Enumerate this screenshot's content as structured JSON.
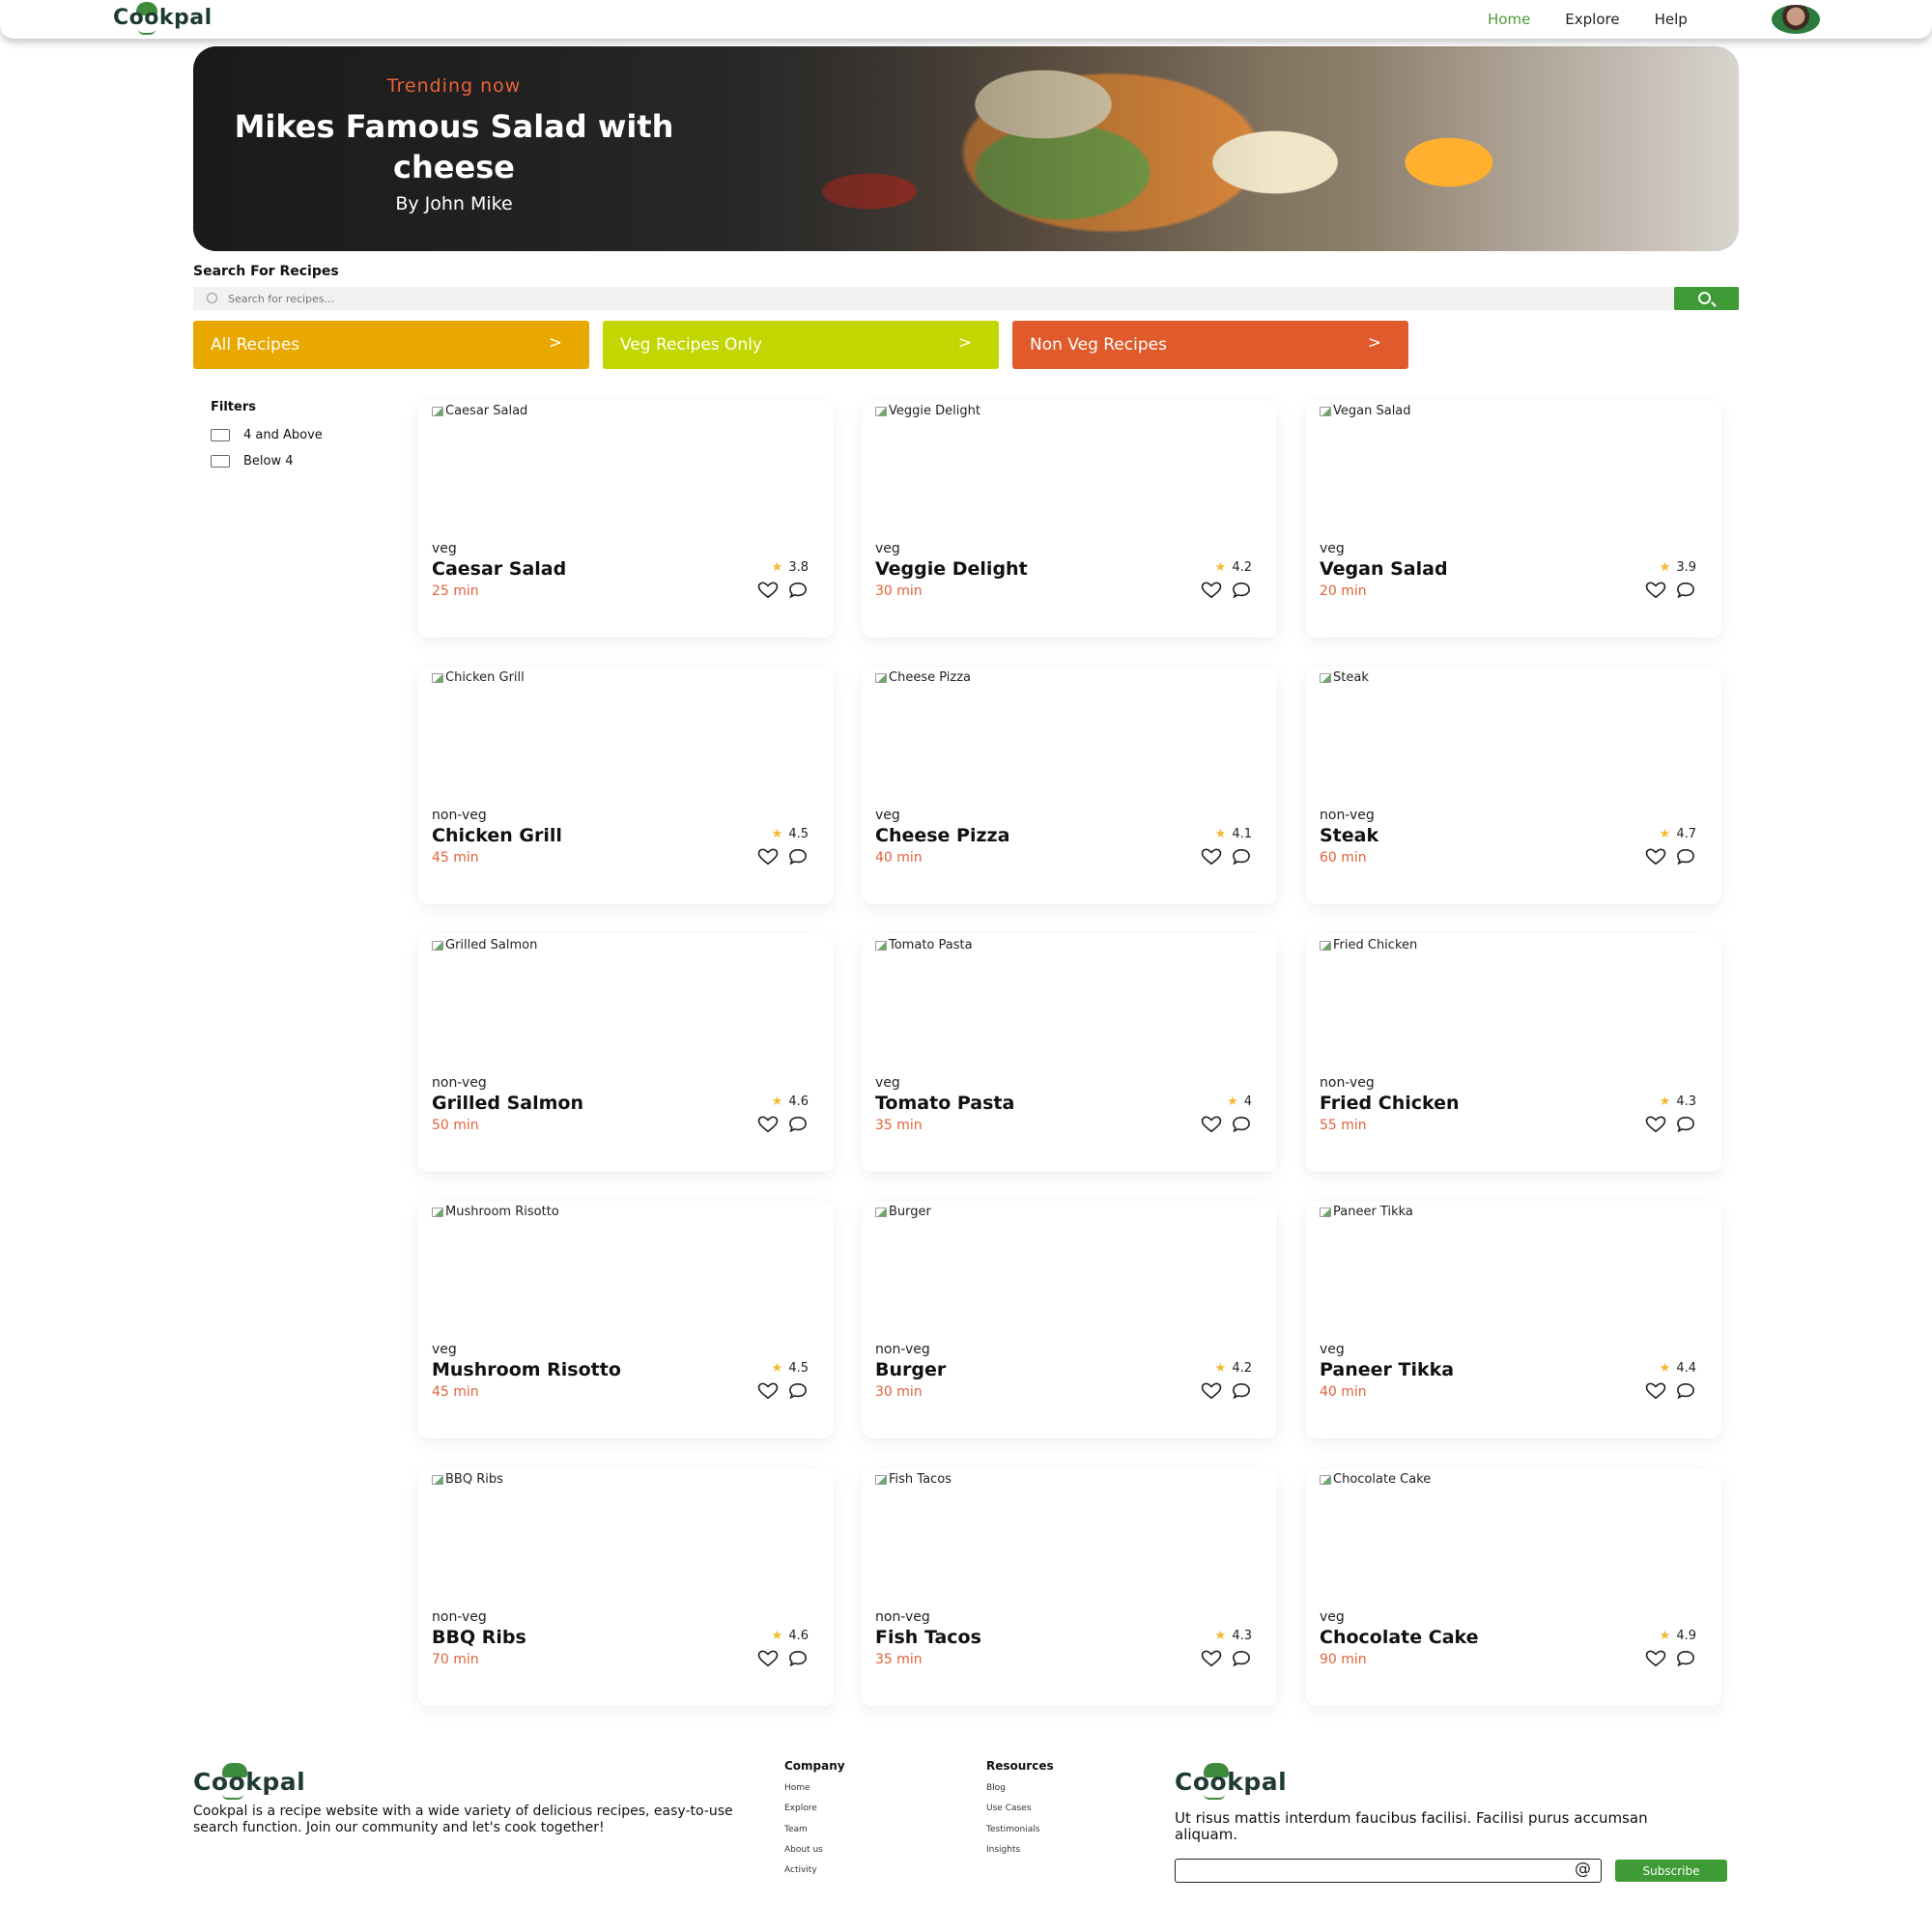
{
  "header": {
    "logo": "Cookpal",
    "nav": [
      {
        "label": "Home",
        "active": true
      },
      {
        "label": "Explore",
        "active": false
      },
      {
        "label": "Help",
        "active": false
      }
    ]
  },
  "hero": {
    "kicker": "Trending now",
    "title": "Mikes Famous Salad with cheese",
    "author": "By John Mike"
  },
  "search": {
    "label": "Search For Recipes",
    "placeholder": "Search for recipes..."
  },
  "categories": [
    {
      "label": "All Recipes",
      "chevron": ">",
      "color": "#e9a800"
    },
    {
      "label": "Veg Recipes Only",
      "chevron": ">",
      "color": "#c3d600"
    },
    {
      "label": "Non Veg Recipes",
      "chevron": ">",
      "color": "#e05a2b"
    }
  ],
  "filters": {
    "title": "Filters",
    "options": [
      "4 and Above",
      "Below 4"
    ]
  },
  "recipes": [
    {
      "name": "Caesar Salad",
      "type": "veg",
      "time": "25 min",
      "rating": "3.8"
    },
    {
      "name": "Veggie Delight",
      "type": "veg",
      "time": "30 min",
      "rating": "4.2"
    },
    {
      "name": "Vegan Salad",
      "type": "veg",
      "time": "20 min",
      "rating": "3.9"
    },
    {
      "name": "Chicken Grill",
      "type": "non-veg",
      "time": "45 min",
      "rating": "4.5"
    },
    {
      "name": "Cheese Pizza",
      "type": "veg",
      "time": "40 min",
      "rating": "4.1"
    },
    {
      "name": "Steak",
      "type": "non-veg",
      "time": "60 min",
      "rating": "4.7"
    },
    {
      "name": "Grilled Salmon",
      "type": "non-veg",
      "time": "50 min",
      "rating": "4.6"
    },
    {
      "name": "Tomato Pasta",
      "type": "veg",
      "time": "35 min",
      "rating": "4"
    },
    {
      "name": "Fried Chicken",
      "type": "non-veg",
      "time": "55 min",
      "rating": "4.3"
    },
    {
      "name": "Mushroom Risotto",
      "type": "veg",
      "time": "45 min",
      "rating": "4.5"
    },
    {
      "name": "Burger",
      "type": "non-veg",
      "time": "30 min",
      "rating": "4.2"
    },
    {
      "name": "Paneer Tikka",
      "type": "veg",
      "time": "40 min",
      "rating": "4.4"
    },
    {
      "name": "BBQ Ribs",
      "type": "non-veg",
      "time": "70 min",
      "rating": "4.6"
    },
    {
      "name": "Fish Tacos",
      "type": "non-veg",
      "time": "35 min",
      "rating": "4.3"
    },
    {
      "name": "Chocolate Cake",
      "type": "veg",
      "time": "90 min",
      "rating": "4.9"
    }
  ],
  "footer": {
    "logo": "Cookpal",
    "about": "Cookpal is a recipe website with a wide variety of delicious recipes, easy-to-use search function. Join our community and let's cook together!",
    "company": {
      "title": "Company",
      "links": [
        "Home",
        "Explore",
        "Team",
        "About us",
        "Activity"
      ]
    },
    "resources": {
      "title": "Resources",
      "links": [
        "Blog",
        "Use Cases",
        "Testimonials",
        "Insights"
      ]
    },
    "logo2": "Cookpal",
    "newsletter_text": "Ut risus mattis interdum faucibus facilisi. Facilisi purus accumsan aliquam.",
    "email_placeholder": "",
    "subscribe_label": "Subscribe"
  },
  "colors": {
    "brand_green": "#3e9b35",
    "accent_orange": "#e0623a",
    "star": "#f5b82e"
  }
}
